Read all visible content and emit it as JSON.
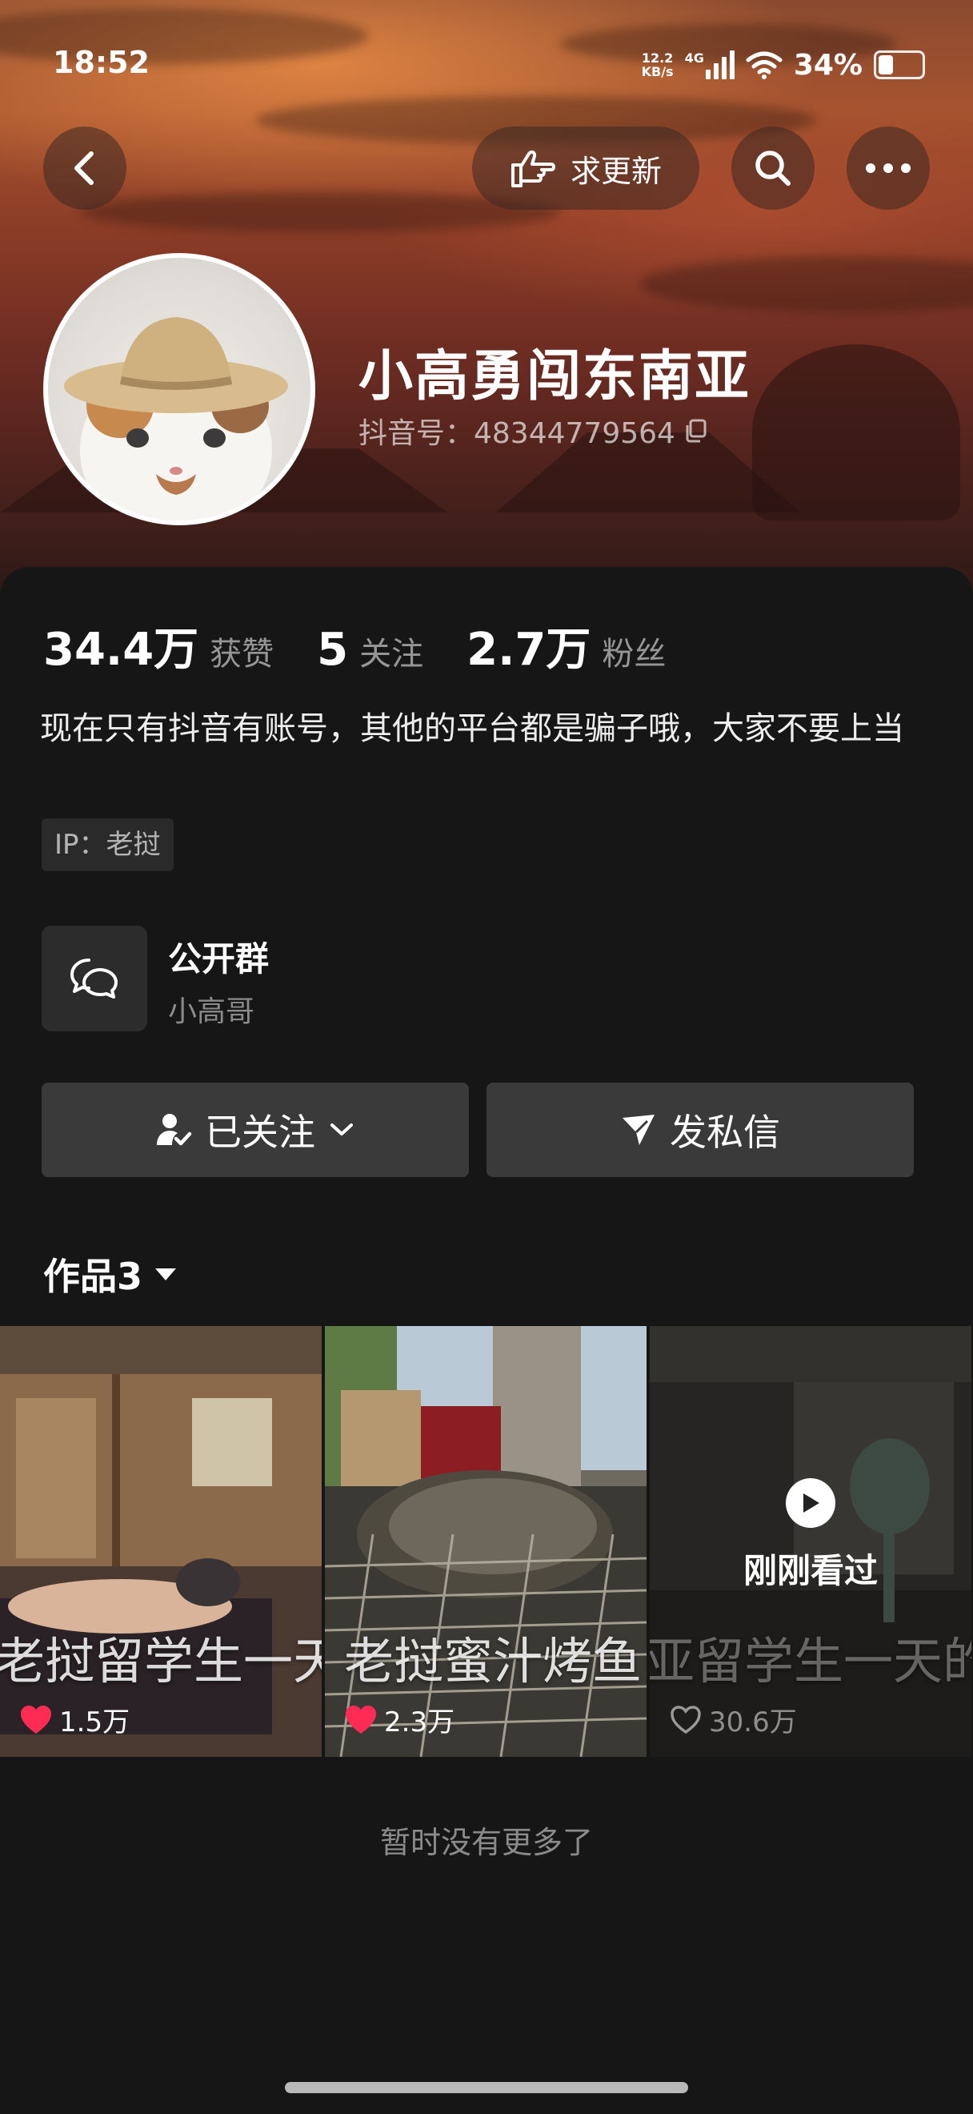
{
  "status_bar": {
    "time": "18:52",
    "net_speed_value": "12.2",
    "net_speed_unit": "KB/s",
    "network_type": "4G",
    "battery_percent": "34%",
    "battery_level": 0.34
  },
  "header": {
    "request_update_label": "求更新",
    "back_icon": "chevron-left-icon",
    "search_icon": "search-icon",
    "more_icon": "more-horizontal-icon"
  },
  "profile": {
    "nickname": "小高勇闯东南亚",
    "douyin_id": "抖音号：48344779564",
    "copy_icon": "copy-icon"
  },
  "stats": [
    {
      "value": "34.4万",
      "label": "获赞"
    },
    {
      "value": "5",
      "label": "关注"
    },
    {
      "value": "2.7万",
      "label": "粉丝"
    }
  ],
  "bio": "现在只有抖音有账号，其他的平台都是骗子哦，大家不要上当",
  "ip_tag": "IP：老挝",
  "group": {
    "title": "公开群",
    "subtitle": "小高哥",
    "icon": "chat-bubbles-icon"
  },
  "actions": {
    "followed_label": "已关注",
    "message_label": "发私信"
  },
  "works_tab": {
    "label": "作品3"
  },
  "videos": [
    {
      "title": "老挝留学生一天",
      "likes": "1.5万",
      "liked": true
    },
    {
      "title": "老挝蜜汁烤鱼",
      "likes": "2.3万",
      "liked": true
    },
    {
      "title": "亚留学生一天的",
      "likes": "30.6万",
      "liked": false,
      "overlay": "刚刚看过"
    }
  ],
  "footer": {
    "no_more_text": "暂时没有更多了"
  },
  "colors": {
    "background": "#161616",
    "button_bg": "#3a3a3a",
    "like_red": "#fe2c55"
  }
}
